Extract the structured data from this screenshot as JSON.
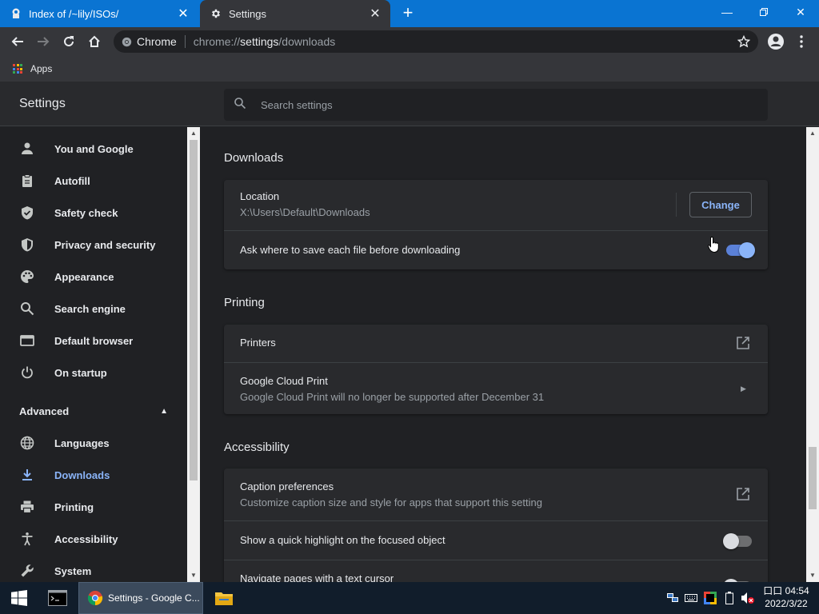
{
  "tabs": [
    {
      "title": "Index of /~lily/ISOs/",
      "icon": "page-icon",
      "active": false
    },
    {
      "title": "Settings",
      "icon": "gear-icon",
      "active": true
    }
  ],
  "toolbar": {
    "omnibox_site": "Chrome",
    "url_prefix": "chrome://",
    "url_host": "settings",
    "url_path": "/downloads"
  },
  "bookmarks": {
    "apps_label": "Apps"
  },
  "settings": {
    "title": "Settings",
    "search_placeholder": "Search settings"
  },
  "sidebar": {
    "items": [
      {
        "label": "You and Google",
        "icon": "person-icon"
      },
      {
        "label": "Autofill",
        "icon": "clipboard-icon"
      },
      {
        "label": "Safety check",
        "icon": "shield-check-icon"
      },
      {
        "label": "Privacy and security",
        "icon": "shield-icon"
      },
      {
        "label": "Appearance",
        "icon": "palette-icon"
      },
      {
        "label": "Search engine",
        "icon": "search-icon"
      },
      {
        "label": "Default browser",
        "icon": "browser-icon"
      },
      {
        "label": "On startup",
        "icon": "power-icon"
      }
    ],
    "advanced_label": "Advanced",
    "advanced_items": [
      {
        "label": "Languages",
        "icon": "globe-icon",
        "active": false
      },
      {
        "label": "Downloads",
        "icon": "download-icon",
        "active": true
      },
      {
        "label": "Printing",
        "icon": "printer-icon",
        "active": false
      },
      {
        "label": "Accessibility",
        "icon": "accessibility-icon",
        "active": false
      },
      {
        "label": "System",
        "icon": "wrench-icon",
        "active": false
      }
    ]
  },
  "downloads": {
    "title": "Downloads",
    "location_label": "Location",
    "location_value": "X:\\Users\\Default\\Downloads",
    "change_label": "Change",
    "ask_label": "Ask where to save each file before downloading",
    "ask_enabled": true
  },
  "printing": {
    "title": "Printing",
    "printers_label": "Printers",
    "cloud_label": "Google Cloud Print",
    "cloud_sub": "Google Cloud Print will no longer be supported after December 31"
  },
  "accessibility": {
    "title": "Accessibility",
    "caption_label": "Caption preferences",
    "caption_sub": "Customize caption size and style for apps that support this setting",
    "highlight_label": "Show a quick highlight on the focused object",
    "highlight_enabled": false,
    "caret_label": "Navigate pages with a text cursor"
  },
  "taskbar": {
    "chrome_label": "Settings - Google C...",
    "time": "04:54",
    "time_prefix": "口口",
    "date": "2022/3/22"
  },
  "colors": {
    "titlebar": "#0a74d2",
    "accent": "#8ab4f8",
    "background": "#202124",
    "card": "#292a2d"
  }
}
